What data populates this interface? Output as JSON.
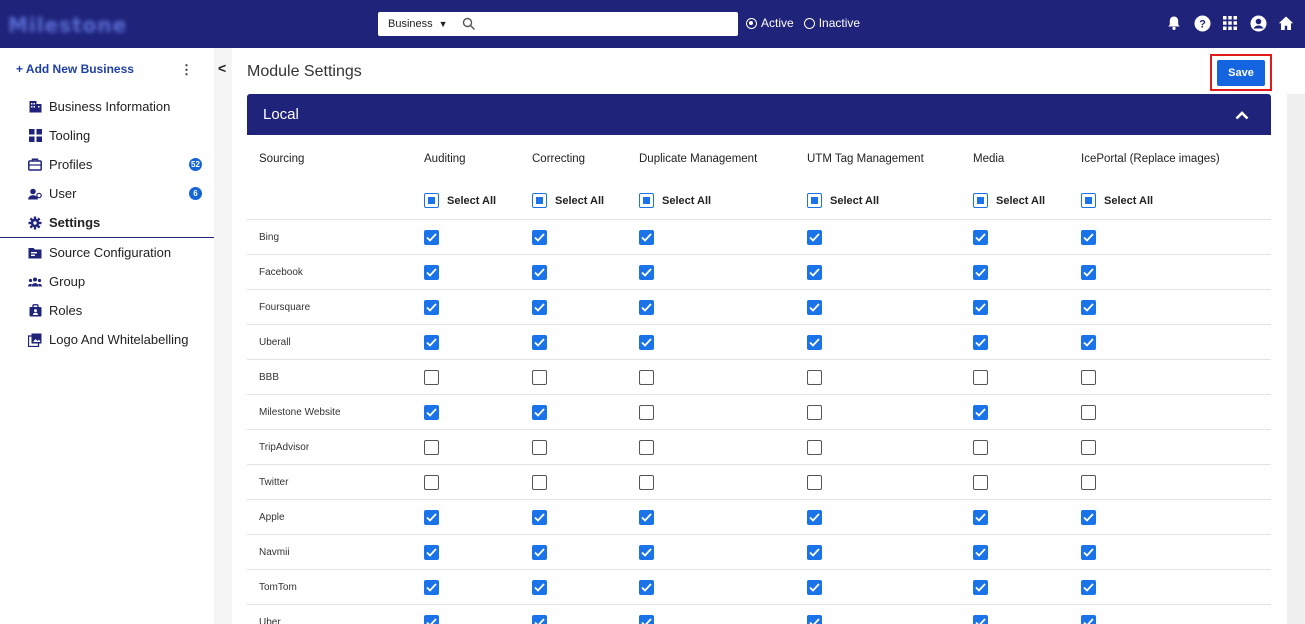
{
  "header": {
    "logo_text": "Milestone",
    "biz_select": "Business",
    "search_placeholder": "",
    "status_options": [
      {
        "label": "Active",
        "selected": true
      },
      {
        "label": "Inactive",
        "selected": false
      }
    ],
    "icons": [
      "bell-icon",
      "help-icon",
      "apps-grid-icon",
      "account-icon",
      "home-icon"
    ]
  },
  "sidebar": {
    "add_label": "+ Add New Business",
    "kebab": "⋮",
    "items": [
      {
        "label": "Business Information",
        "icon": "building-icon"
      },
      {
        "label": "Tooling",
        "icon": "tooling-icon"
      },
      {
        "label": "Profiles",
        "icon": "briefcase-icon",
        "badge": "52"
      },
      {
        "label": "User",
        "icon": "users-icon",
        "badge": "6"
      },
      {
        "label": "Settings",
        "icon": "gear-icon",
        "active": true
      },
      {
        "label": "Source Configuration",
        "icon": "folder-icon"
      },
      {
        "label": "Group",
        "icon": "group-icon"
      },
      {
        "label": "Roles",
        "icon": "roles-icon"
      },
      {
        "label": "Logo And Whitelabelling",
        "icon": "image-icon"
      }
    ]
  },
  "collapse_glyph": "<",
  "main": {
    "title": "Module Settings",
    "save_label": "Save",
    "section_title": "Local",
    "columns": {
      "sourcing": "Sourcing",
      "modules": [
        "Auditing",
        "Correcting",
        "Duplicate Management",
        "UTM Tag Management",
        "Media",
        "IcePortal (Replace images)"
      ]
    },
    "select_all_label": "Select All",
    "rows": [
      {
        "name": "Bing",
        "checks": [
          true,
          true,
          true,
          true,
          true,
          true
        ]
      },
      {
        "name": "Facebook",
        "checks": [
          true,
          true,
          true,
          true,
          true,
          true
        ]
      },
      {
        "name": "Foursquare",
        "checks": [
          true,
          true,
          true,
          true,
          true,
          true
        ]
      },
      {
        "name": "Uberall",
        "checks": [
          true,
          true,
          true,
          true,
          true,
          true
        ]
      },
      {
        "name": "BBB",
        "checks": [
          false,
          false,
          false,
          false,
          false,
          false
        ]
      },
      {
        "name": "Milestone Website",
        "checks": [
          true,
          true,
          false,
          false,
          true,
          false
        ]
      },
      {
        "name": "TripAdvisor",
        "checks": [
          false,
          false,
          false,
          false,
          false,
          false
        ]
      },
      {
        "name": "Twitter",
        "checks": [
          false,
          false,
          false,
          false,
          false,
          false
        ]
      },
      {
        "name": "Apple",
        "checks": [
          true,
          true,
          true,
          true,
          true,
          true
        ]
      },
      {
        "name": "Navmii",
        "checks": [
          true,
          true,
          true,
          true,
          true,
          true
        ]
      },
      {
        "name": "TomTom",
        "checks": [
          true,
          true,
          true,
          true,
          true,
          true
        ]
      },
      {
        "name": "Uber",
        "checks": [
          true,
          true,
          true,
          true,
          true,
          true
        ]
      }
    ]
  },
  "colors": {
    "header_bg": "#1f237a",
    "accent": "#1a73e8",
    "save_outline": "#e01b1b"
  }
}
